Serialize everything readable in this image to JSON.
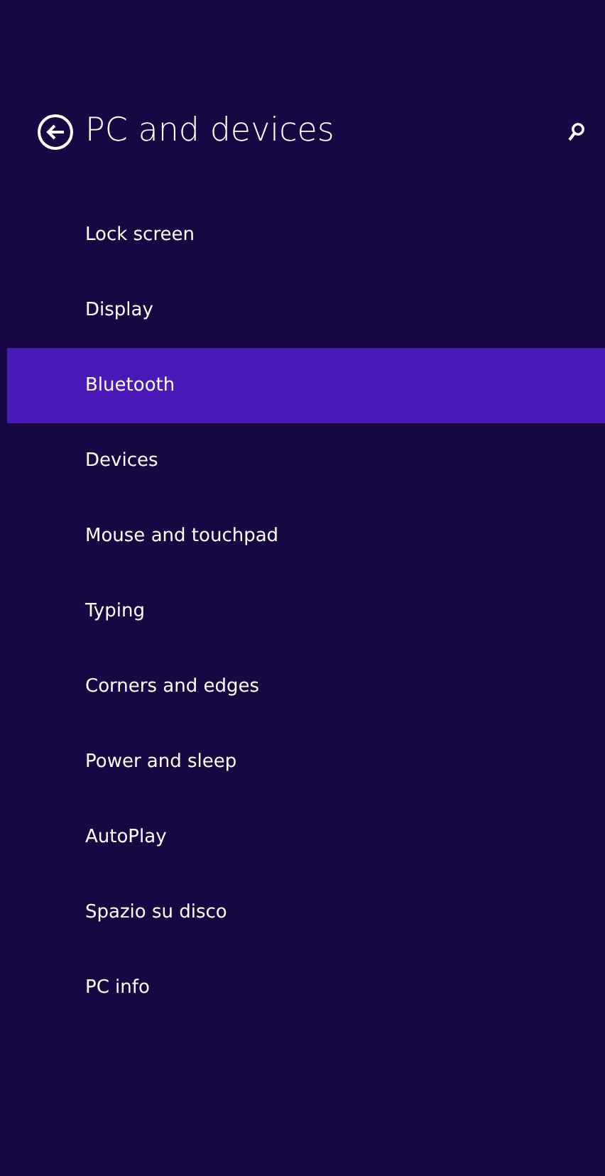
{
  "header": {
    "title": "PC and devices"
  },
  "menu": [
    {
      "label": "Lock screen",
      "selected": false
    },
    {
      "label": "Display",
      "selected": false
    },
    {
      "label": "Bluetooth",
      "selected": true
    },
    {
      "label": "Devices",
      "selected": false
    },
    {
      "label": "Mouse and touchpad",
      "selected": false
    },
    {
      "label": "Typing",
      "selected": false
    },
    {
      "label": "Corners and edges",
      "selected": false
    },
    {
      "label": "Power and sleep",
      "selected": false
    },
    {
      "label": "AutoPlay",
      "selected": false
    },
    {
      "label": "Spazio su disco",
      "selected": false
    },
    {
      "label": "PC info",
      "selected": false
    }
  ]
}
